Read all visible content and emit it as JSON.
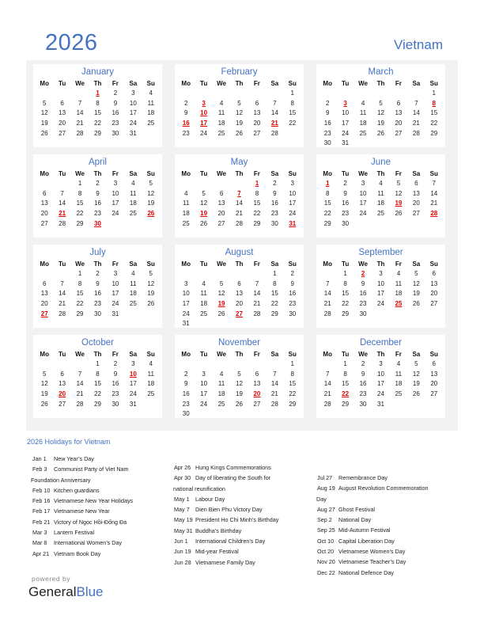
{
  "header": {
    "year": "2026",
    "country": "Vietnam"
  },
  "weekdays": [
    "Mo",
    "Tu",
    "We",
    "Th",
    "Fr",
    "Sa",
    "Su"
  ],
  "months": [
    {
      "name": "January",
      "start": 3,
      "days": 31,
      "holidays": [
        1
      ]
    },
    {
      "name": "February",
      "start": 6,
      "days": 28,
      "holidays": [
        3,
        10,
        16,
        17,
        21
      ]
    },
    {
      "name": "March",
      "start": 6,
      "days": 31,
      "holidays": [
        3,
        8
      ]
    },
    {
      "name": "April",
      "start": 2,
      "days": 30,
      "holidays": [
        21,
        26,
        30
      ]
    },
    {
      "name": "May",
      "start": 4,
      "days": 31,
      "holidays": [
        1,
        7,
        19,
        31
      ]
    },
    {
      "name": "June",
      "start": 0,
      "days": 30,
      "holidays": [
        1,
        19,
        28
      ]
    },
    {
      "name": "July",
      "start": 2,
      "days": 31,
      "holidays": [
        27
      ]
    },
    {
      "name": "August",
      "start": 5,
      "days": 31,
      "holidays": [
        19,
        27
      ]
    },
    {
      "name": "September",
      "start": 1,
      "days": 30,
      "holidays": [
        2,
        25
      ]
    },
    {
      "name": "October",
      "start": 3,
      "days": 31,
      "holidays": [
        10,
        20
      ]
    },
    {
      "name": "November",
      "start": 6,
      "days": 30,
      "holidays": [
        20
      ]
    },
    {
      "name": "December",
      "start": 1,
      "days": 31,
      "holidays": [
        22
      ]
    }
  ],
  "holidays_title": "2026 Holidays for Vietnam",
  "holiday_columns": [
    [
      {
        "date": "Jan 1",
        "name": "New Year’s Day"
      },
      {
        "date": "Feb 3",
        "name": "Communist Party of Viet Nam",
        "wrap": "Foundation Anniversary"
      },
      {
        "date": "Feb 10",
        "name": "Kitchen guardians"
      },
      {
        "date": "Feb 16",
        "name": "Vietnamese New Year Holidays"
      },
      {
        "date": "Feb 17",
        "name": "Vietnamese New Year"
      },
      {
        "date": "Feb 21",
        "name": "Victory of Ngọc Hồi-Đống Đa"
      },
      {
        "date": "Mar 3",
        "name": "Lantern Festival"
      },
      {
        "date": "Mar 8",
        "name": "International Women’s Day"
      },
      {
        "date": "Apr 21",
        "name": "Vietnam Book Day"
      }
    ],
    [
      {
        "date": "Apr 26",
        "name": "Hung Kings Commemorations"
      },
      {
        "date": "Apr 30",
        "name": "Day of liberating the South for",
        "wrap": "national reunification"
      },
      {
        "date": "May 1",
        "name": "Labour Day"
      },
      {
        "date": "May 7",
        "name": "Dien Bien Phu Victory Day"
      },
      {
        "date": "May 19",
        "name": "President Ho Chi Minh’s Birthday"
      },
      {
        "date": "May 31",
        "name": "Buddha’s Birthday"
      },
      {
        "date": "Jun 1",
        "name": "International Children’s Day"
      },
      {
        "date": "Jun 19",
        "name": "Mid-year Festival"
      },
      {
        "date": "Jun 28",
        "name": "Vietnamese Family Day"
      }
    ],
    [
      {
        "date": "Jul 27",
        "name": "Remembrance Day"
      },
      {
        "date": "Aug 19",
        "name": "August Revolution Commemoration",
        "wrap": "Day"
      },
      {
        "date": "Aug 27",
        "name": "Ghost Festival"
      },
      {
        "date": "Sep 2",
        "name": "National Day"
      },
      {
        "date": "Sep 25",
        "name": "Mid-Autumn Festival"
      },
      {
        "date": "Oct 10",
        "name": "Capital Liberation Day"
      },
      {
        "date": "Oct 20",
        "name": "Vietnamese Women’s Day"
      },
      {
        "date": "Nov 20",
        "name": "Vietnamese Teacher’s Day"
      },
      {
        "date": "Dec 22",
        "name": "National Defence Day"
      }
    ]
  ],
  "footer": {
    "powered_by": "powered by",
    "brand_general": "General",
    "brand_blue": "Blue"
  },
  "colors": {
    "accent": "#4472c4",
    "holiday": "#e00000",
    "panel": "#f2f2f2"
  }
}
